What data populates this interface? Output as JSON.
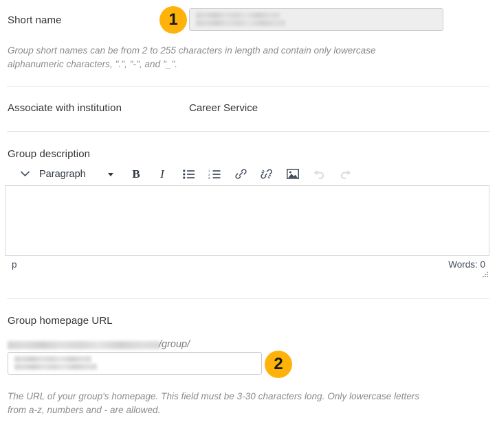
{
  "form": {
    "short_name": {
      "label": "Short name",
      "value": "",
      "help": "Group short names can be from 2 to 255 characters in length and contain only lowercase alphanumeric characters, \".\", \"-\", and \"_\"."
    },
    "institution": {
      "label": "Associate with institution",
      "value": "Career Service"
    },
    "group_description": {
      "label": "Group description",
      "editor": {
        "format_label": "Paragraph",
        "toolbar": [
          {
            "name": "toggle-toolbar-icon",
            "title": "chevron-down"
          },
          {
            "name": "format-select",
            "title": "Paragraph"
          },
          {
            "name": "bold-icon",
            "title": "Bold",
            "glyph": "B"
          },
          {
            "name": "italic-icon",
            "title": "Italic",
            "glyph": "I"
          },
          {
            "name": "bullet-list-icon",
            "title": "Bullet list"
          },
          {
            "name": "numbered-list-icon",
            "title": "Numbered list"
          },
          {
            "name": "link-icon",
            "title": "Insert link"
          },
          {
            "name": "unlink-icon",
            "title": "Remove link"
          },
          {
            "name": "image-icon",
            "title": "Insert image"
          },
          {
            "name": "undo-icon",
            "title": "Undo",
            "disabled": true
          },
          {
            "name": "redo-icon",
            "title": "Redo",
            "disabled": true
          }
        ],
        "content": "",
        "status_path": "p",
        "word_count_label": "Words: 0"
      }
    },
    "homepage_url": {
      "label": "Group homepage URL",
      "prefix_suffix": "/group/",
      "value": "",
      "help": "The URL of your group's homepage. This field must be 3-30 characters long. Only lowercase letters from a-z, numbers and - are allowed."
    }
  },
  "callouts": [
    {
      "number": "1"
    },
    {
      "number": "2"
    }
  ],
  "colors": {
    "callout_background": "#FFB20A",
    "callout_text": "#1a1a1a",
    "label_text": "#333333",
    "helper_text": "#8a8a8a",
    "divider": "#e2e2e2",
    "input_border": "#c9c9c9",
    "disabled_input_background": "#eeeeee",
    "toolbar_icon": "#3f4a58",
    "toolbar_icon_disabled": "#dcdcdc"
  }
}
